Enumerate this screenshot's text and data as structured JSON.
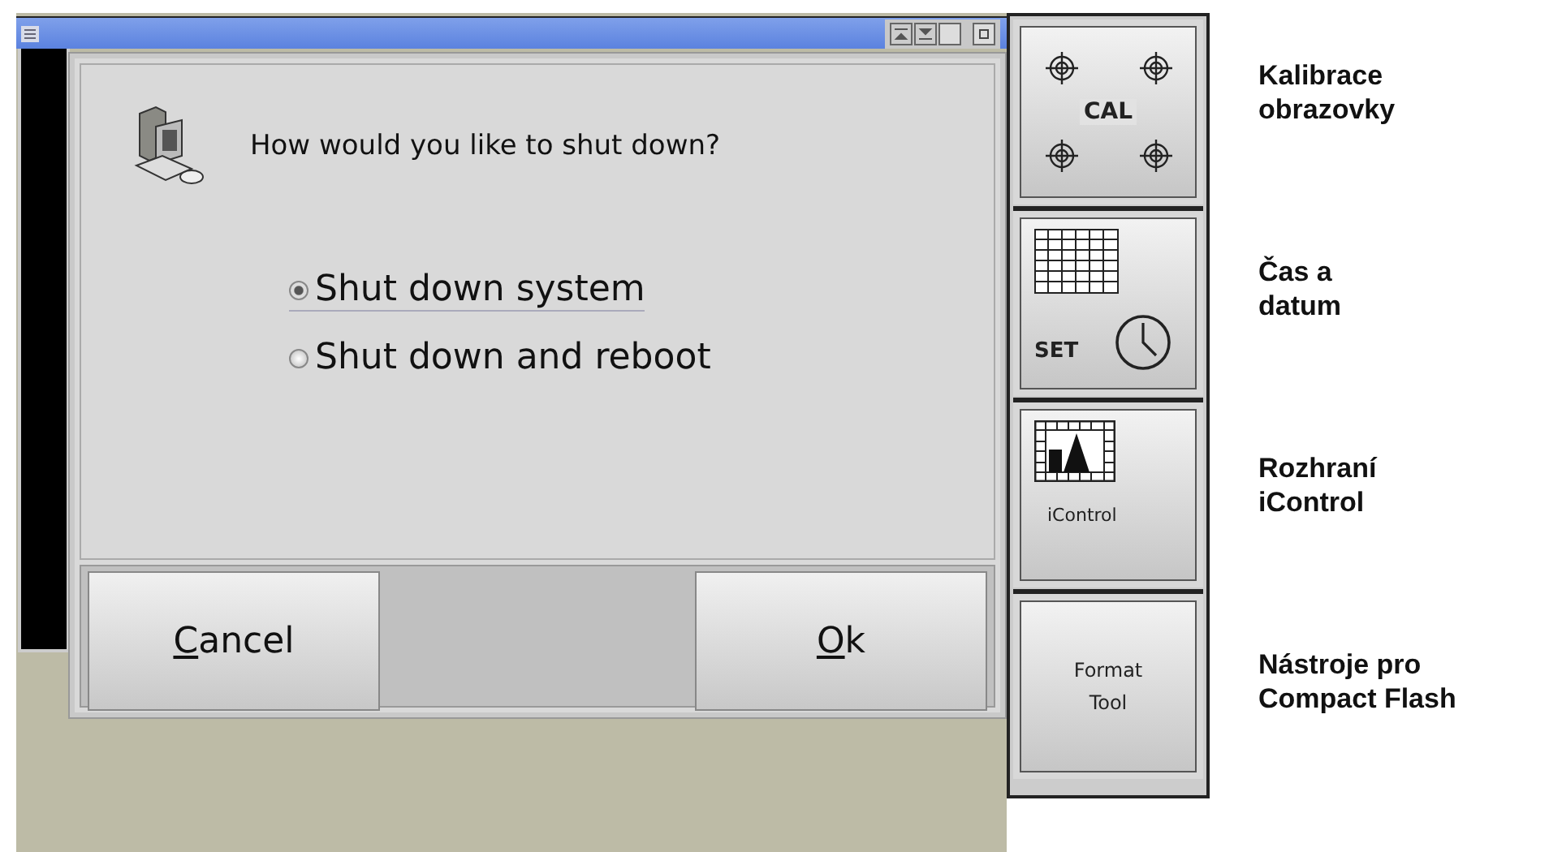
{
  "dialog": {
    "question": "How would you like to shut down?",
    "options": [
      {
        "label": "Shut down system",
        "selected": true
      },
      {
        "label": "Shut down and reboot",
        "selected": false
      }
    ],
    "buttons": [
      "Cancel",
      "Ok"
    ]
  },
  "side_buttons": [
    {
      "kind": "cal",
      "text": "CAL"
    },
    {
      "kind": "clock",
      "text": "SET"
    },
    {
      "kind": "icontrol",
      "text": "iControl"
    },
    {
      "kind": "text",
      "text": "Format\nTool"
    }
  ],
  "captions": [
    "Kalibrace\nobrazovky",
    "Čas a\ndatum",
    "Rozhraní\niControl",
    "Nástroje pro\nCompact Flash"
  ]
}
